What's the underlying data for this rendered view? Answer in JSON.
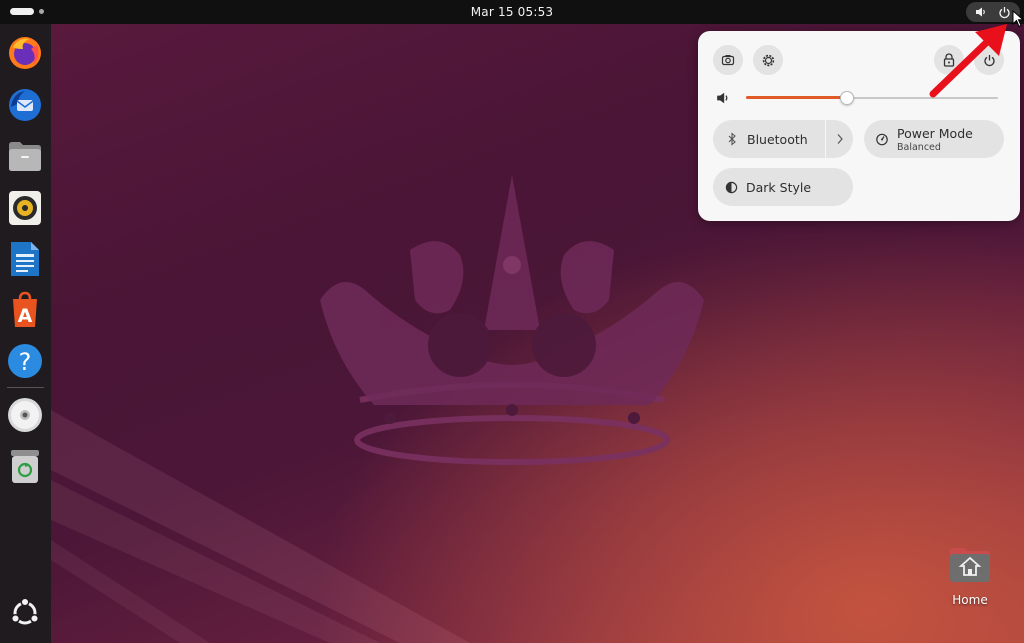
{
  "topbar": {
    "clock": "Mar 15  05:53",
    "tray_icons": [
      "speaker-icon",
      "power-icon"
    ]
  },
  "dock": {
    "items": [
      {
        "name": "firefox",
        "icon": "firefox-icon"
      },
      {
        "name": "thunderbird",
        "icon": "thunderbird-icon"
      },
      {
        "name": "files",
        "icon": "files-icon"
      },
      {
        "name": "rhythmbox",
        "icon": "rhythmbox-icon"
      },
      {
        "name": "libreoffice-writer",
        "icon": "writer-icon"
      },
      {
        "name": "app-center",
        "icon": "app-center-icon"
      },
      {
        "name": "help",
        "icon": "help-icon"
      },
      {
        "name": "disc",
        "icon": "disc-icon"
      },
      {
        "name": "trash",
        "icon": "trash-icon"
      }
    ],
    "show_apps_icon": "ubuntu-logo-icon"
  },
  "quick_settings": {
    "top_buttons": [
      "screenshot-icon",
      "settings-icon",
      "lock-icon",
      "power-icon"
    ],
    "volume": {
      "level": 0.4,
      "icon": "speaker-icon"
    },
    "bluetooth": {
      "label": "Bluetooth",
      "icon": "bluetooth-icon"
    },
    "power_mode": {
      "label": "Power Mode",
      "sublabel": "Balanced",
      "icon": "power-mode-icon"
    },
    "dark_style": {
      "label": "Dark Style",
      "icon": "dark-style-icon"
    },
    "accent_color": "#e05a26"
  },
  "desktop": {
    "home_label": "Home"
  }
}
